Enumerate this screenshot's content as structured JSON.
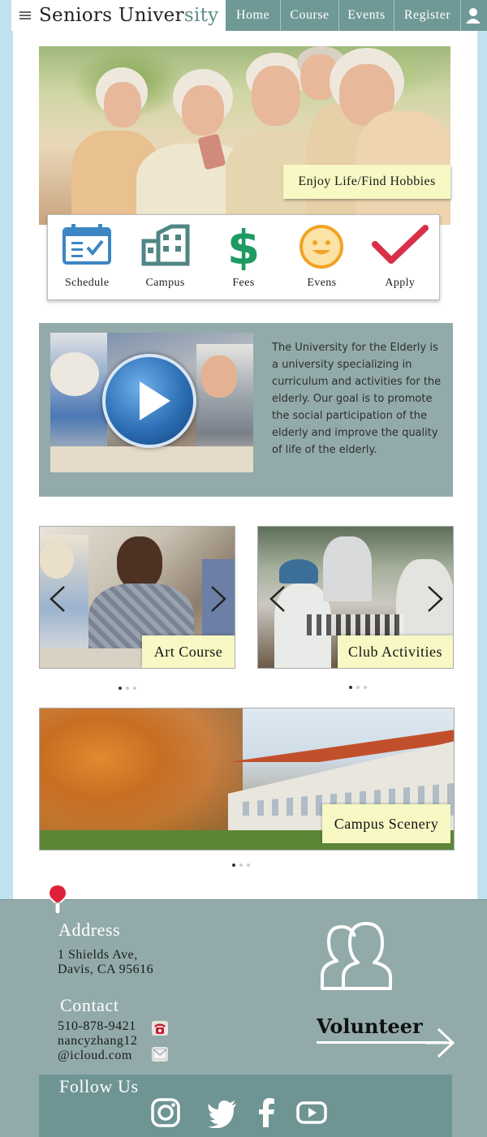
{
  "header": {
    "brand_part1": "Seniors Univer",
    "brand_part2": "sity",
    "nav": [
      "Home",
      "Course",
      "Events",
      "Register"
    ]
  },
  "hero": {
    "label": "Enjoy Life/Find Hobbies"
  },
  "quick_links": [
    {
      "label": "Schedule",
      "icon": "calendar-icon"
    },
    {
      "label": "Campus",
      "icon": "building-icon"
    },
    {
      "label": "Fees",
      "icon": "dollar-icon"
    },
    {
      "label": "Evens",
      "icon": "smiley-icon"
    },
    {
      "label": "Apply",
      "icon": "checkmark-icon"
    }
  ],
  "intro": {
    "text": "The University for the Elderly is a university specializing in curriculum and activities for the elderly. Our goal is to promote the social participation of the elderly and improve the quality of life of the elderly."
  },
  "cards": {
    "art": "Art Course",
    "club": "Club Activities",
    "scenery": "Campus Scenery"
  },
  "footer": {
    "address_title": "Address",
    "address_line1": "1 Shields Ave,",
    "address_line2": "Davis, CA 95616",
    "contact_title": "Contact",
    "phone": "510-878-9421",
    "email_line1": "nancyzhang12",
    "email_line2": "@icloud.com",
    "volunteer": "Volunteer",
    "follow_title": "Follow Us",
    "social": [
      "instagram-icon",
      "twitter-icon",
      "facebook-icon",
      "youtube-icon"
    ]
  },
  "colors": {
    "nav_bg": "#6f9996",
    "accent": "#5d8d89",
    "label_bg": "#f7f8c4",
    "section_bg": "#92abaa",
    "page_bg": "#bfe2ee"
  }
}
